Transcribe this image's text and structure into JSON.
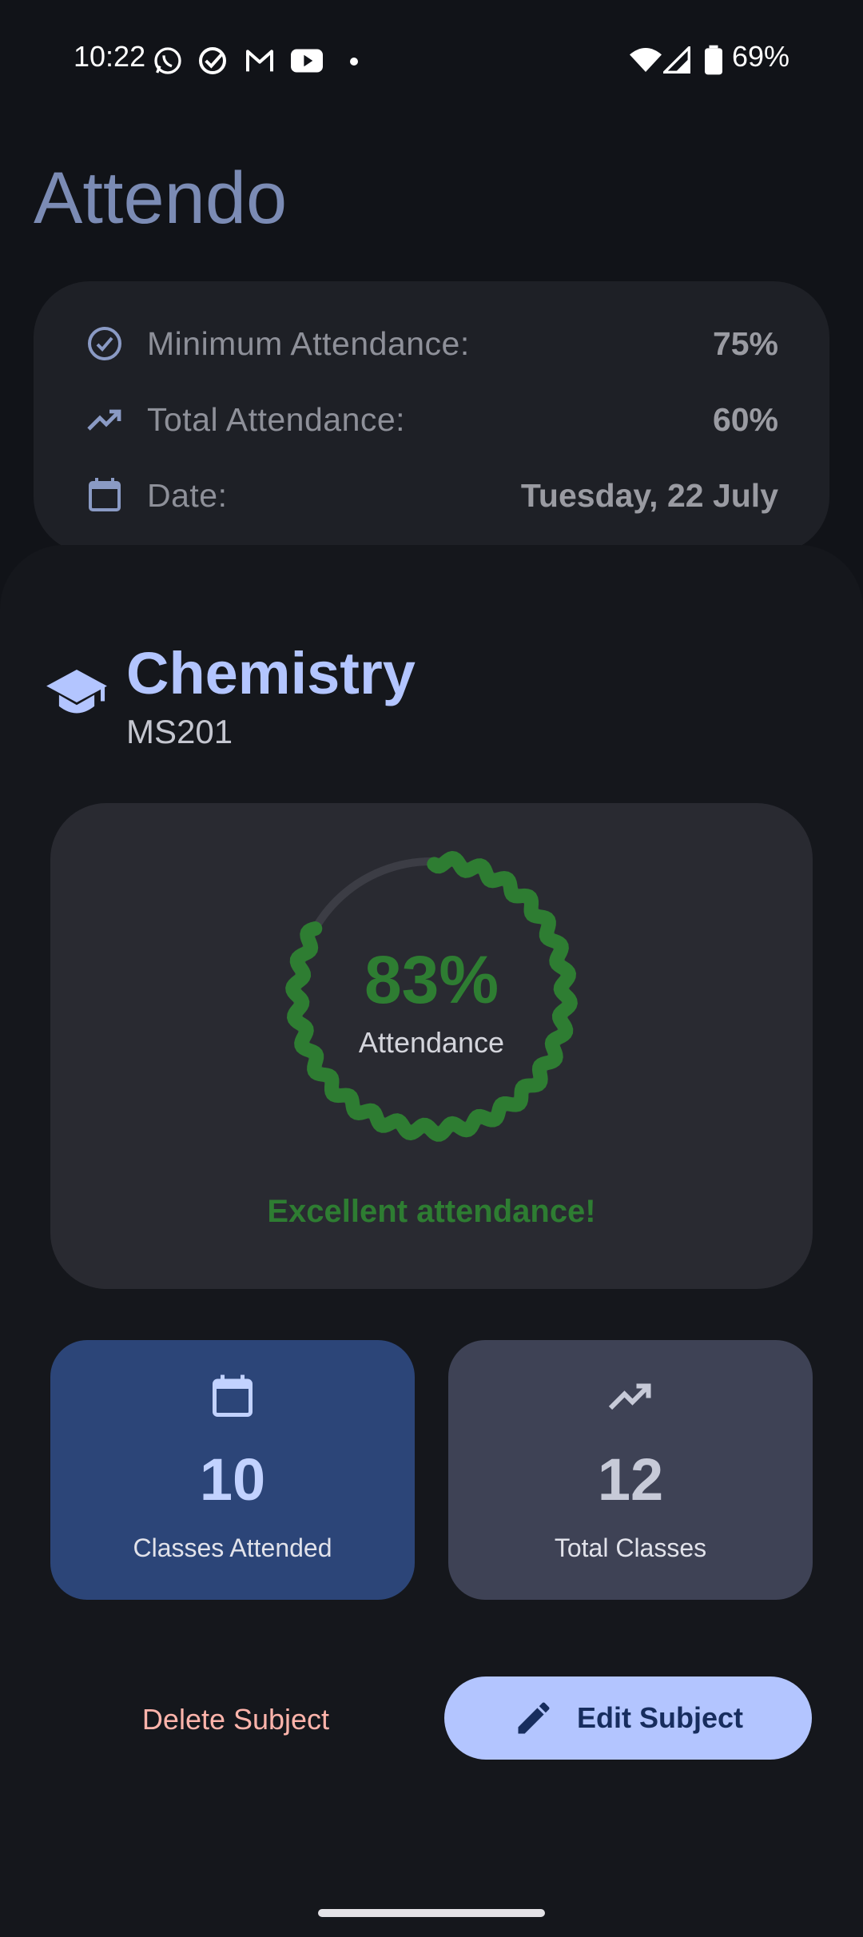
{
  "status_bar": {
    "time": "10:22",
    "battery": "69%",
    "notification_icons": [
      "whatsapp-icon",
      "check-circle-icon",
      "gmail-icon",
      "youtube-icon",
      "dot-icon"
    ],
    "system_icons": [
      "wifi-icon",
      "signal-icon",
      "battery-icon"
    ]
  },
  "app": {
    "title": "Attendo"
  },
  "summary": {
    "min_label": "Minimum Attendance:",
    "min_value": "75%",
    "total_label": "Total Attendance:",
    "total_value": "60%",
    "date_label": "Date:",
    "date_value": "Tuesday, 22 July"
  },
  "subject": {
    "name": "Chemistry",
    "code": "MS201",
    "percentage_text": "83%",
    "percentage_value": 0.83,
    "percentage_label": "Attendance",
    "verdict": "Excellent attendance!",
    "attended_value": "10",
    "attended_label": "Classes Attended",
    "total_value": "12",
    "total_label": "Total Classes"
  },
  "actions": {
    "delete_label": "Delete Subject",
    "edit_label": "Edit Subject"
  },
  "colors": {
    "accent": "#b3c5ff",
    "success": "#2e7d32",
    "danger": "#ffb4ab",
    "background": "#111318"
  }
}
